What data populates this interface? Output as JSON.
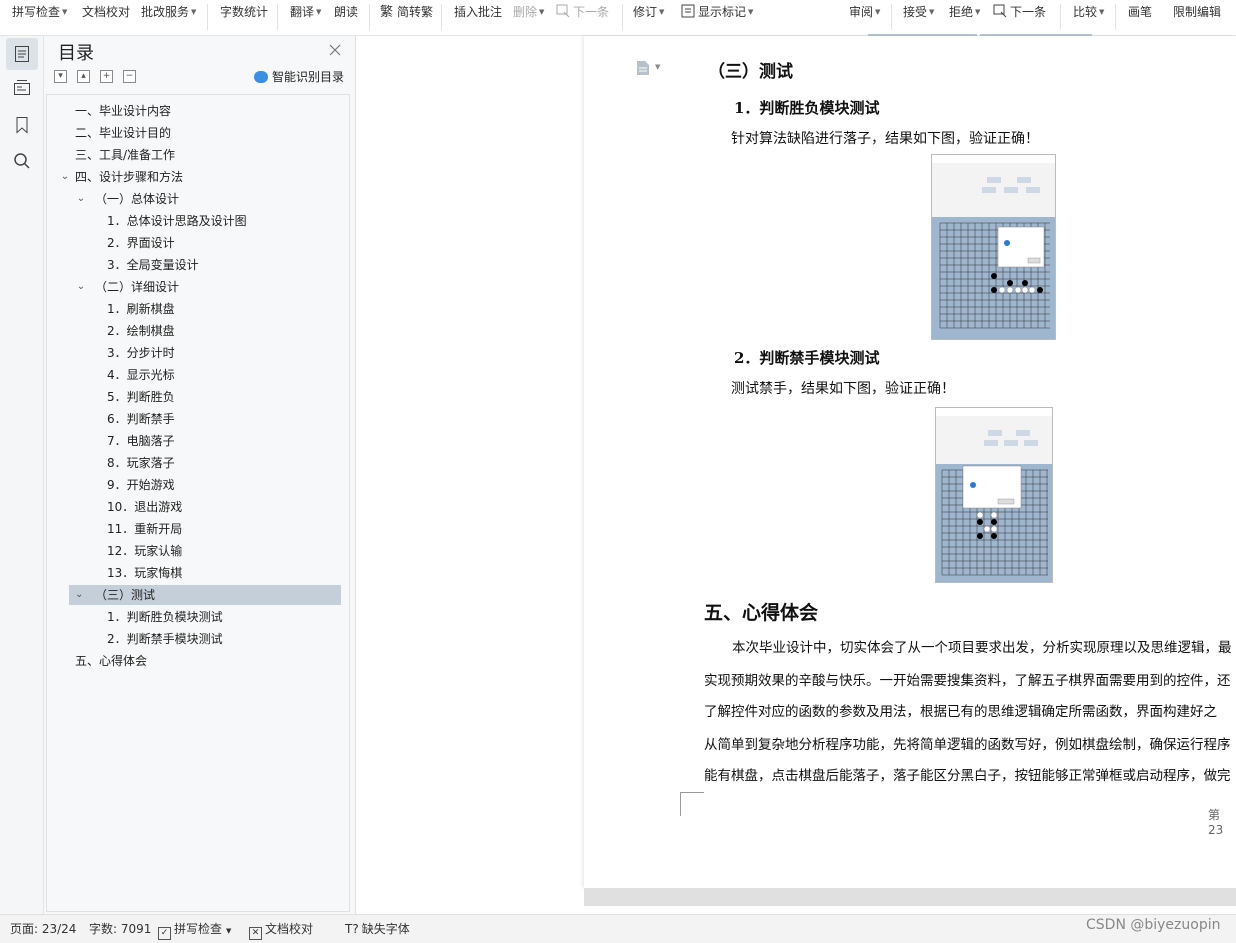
{
  "toolbar": {
    "items": [
      {
        "label": "拼写检查",
        "caret": true
      },
      {
        "label": "文档校对"
      },
      {
        "label": "批改服务",
        "caret": true
      },
      {
        "label": "字数统计"
      },
      {
        "label": "翻译",
        "caret": true
      },
      {
        "label": "朗读"
      },
      {
        "label": "简转繁"
      },
      {
        "label": "插入批注"
      },
      {
        "label": "删除",
        "caret": true,
        "disabled": true
      },
      {
        "label": "下一条",
        "disabled": true
      },
      {
        "label": "修订",
        "caret": true
      },
      {
        "label": "显示标记",
        "caret": true
      },
      {
        "label": "审阅",
        "caret": true
      },
      {
        "label": "接受",
        "caret": true
      },
      {
        "label": "拒绝",
        "caret": true
      },
      {
        "label": "下一条"
      },
      {
        "label": "比较",
        "caret": true
      },
      {
        "label": "画笔"
      },
      {
        "label": "限制编辑"
      }
    ]
  },
  "toc": {
    "title": "目录",
    "smart_label": "智能识别目录",
    "items": [
      {
        "label": "一、毕业设计内容"
      },
      {
        "label": "二、毕业设计目的"
      },
      {
        "label": "三、工具/准备工作"
      },
      {
        "label": "四、设计步骤和方法",
        "expanded": true
      },
      {
        "label": "（一）总体设计",
        "expanded": true
      },
      {
        "label": "1．总体设计思路及设计图"
      },
      {
        "label": "2．界面设计"
      },
      {
        "label": "3．全局变量设计"
      },
      {
        "label": "（二）详细设计",
        "expanded": true
      },
      {
        "label": "1．刷新棋盘"
      },
      {
        "label": "2．绘制棋盘"
      },
      {
        "label": "3．分步计时"
      },
      {
        "label": "4．显示光标"
      },
      {
        "label": "5．判断胜负"
      },
      {
        "label": "6．判断禁手"
      },
      {
        "label": "7．电脑落子"
      },
      {
        "label": "8．玩家落子"
      },
      {
        "label": "9．开始游戏"
      },
      {
        "label": "10．退出游戏"
      },
      {
        "label": "11．重新开局"
      },
      {
        "label": "12．玩家认输"
      },
      {
        "label": "13．玩家悔棋"
      },
      {
        "label": "（三）测试",
        "expanded": true,
        "selected": true
      },
      {
        "label": "1．判断胜负模块测试"
      },
      {
        "label": "2．判断禁手模块测试"
      },
      {
        "label": "五、心得体会"
      }
    ]
  },
  "document": {
    "section_title": "（三）测试",
    "sub1_title": "1．判断胜负模块测试",
    "sub1_text": "针对算法缺陷进行落子，结果如下图，验证正确！",
    "sub2_title": "2．判断禁手模块测试",
    "sub2_text": "测试禁手，结果如下图，验证正确！",
    "heading5": "五、心得体会",
    "paragraph_lines": [
      "本次毕业设计中，切实体会了从一个项目要求出发，分析实现原理以及思维逻辑，最",
      "实现预期效果的辛酸与快乐。一开始需要搜集资料，了解五子棋界面需要用到的控件，还",
      "了解控件对应的函数的参数及用法，根据已有的思维逻辑确定所需函数，界面构建好之",
      "从简单到复杂地分析程序功能，先将简单逻辑的函数写好，例如棋盘绘制，确保运行程序",
      "能有棋盘，点击棋盘后能落子，落子能区分黑白子，按钮能够正常弹框或启动程序，做完"
    ],
    "page_number": "第 23"
  },
  "status": {
    "page": "页面: 23/24",
    "words": "字数: 7091",
    "spell": "拼写检查",
    "proof": "文档校对",
    "font": "缺失字体"
  },
  "watermark": "CSDN @biyezuopin"
}
